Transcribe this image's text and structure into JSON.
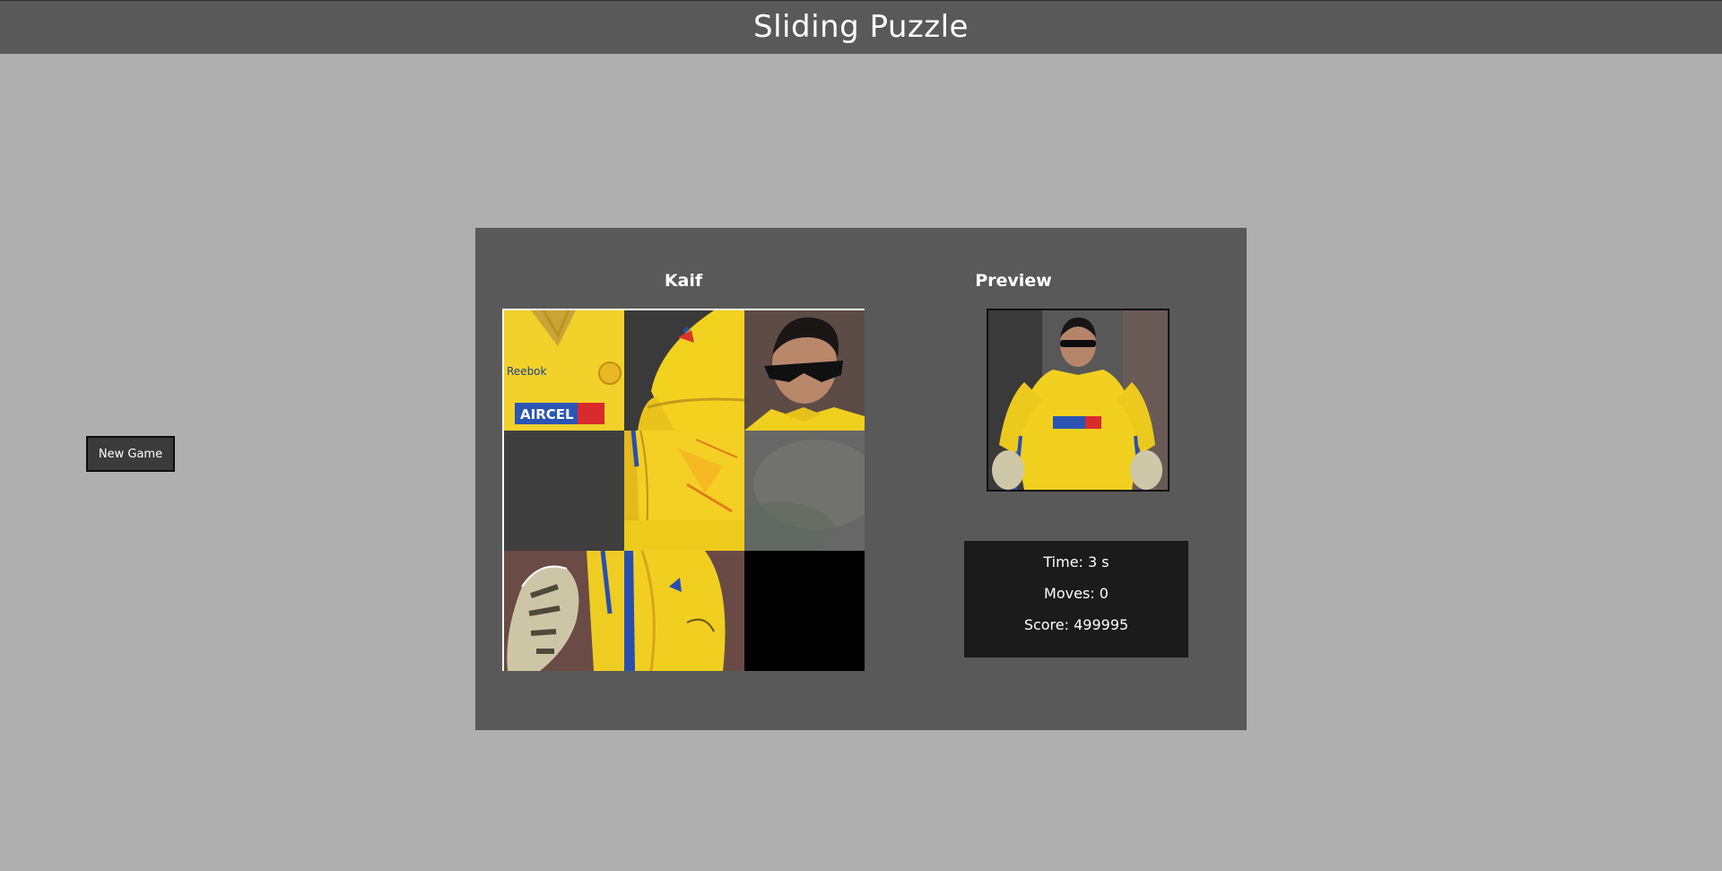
{
  "header": {
    "title": "Sliding Puzzle"
  },
  "controls": {
    "new_game_label": "New Game"
  },
  "puzzle": {
    "name": "Kaif",
    "grid_size": 3,
    "tiles": [
      {
        "piece": "jersey-chest-logos"
      },
      {
        "piece": "shoulder-arm"
      },
      {
        "piece": "face-sunglasses"
      },
      {
        "piece": "background-dark"
      },
      {
        "piece": "jersey-lower-arm"
      },
      {
        "piece": "background-blurred"
      },
      {
        "piece": "glove-left"
      },
      {
        "piece": "jersey-side-logo"
      },
      {
        "piece": "empty"
      }
    ]
  },
  "preview": {
    "title": "Preview"
  },
  "stats": {
    "time": "Time: 3 s",
    "moves": "Moves: 0",
    "score": "Score: 499995"
  },
  "colors": {
    "header_bg": "#595959",
    "page_bg": "#afafaf",
    "panel_bg": "#595959",
    "stats_bg": "#1b1b1b",
    "jersey_yellow": "#f4d21f",
    "jersey_blue": "#2a4fb0",
    "jersey_red": "#d92b2b"
  }
}
